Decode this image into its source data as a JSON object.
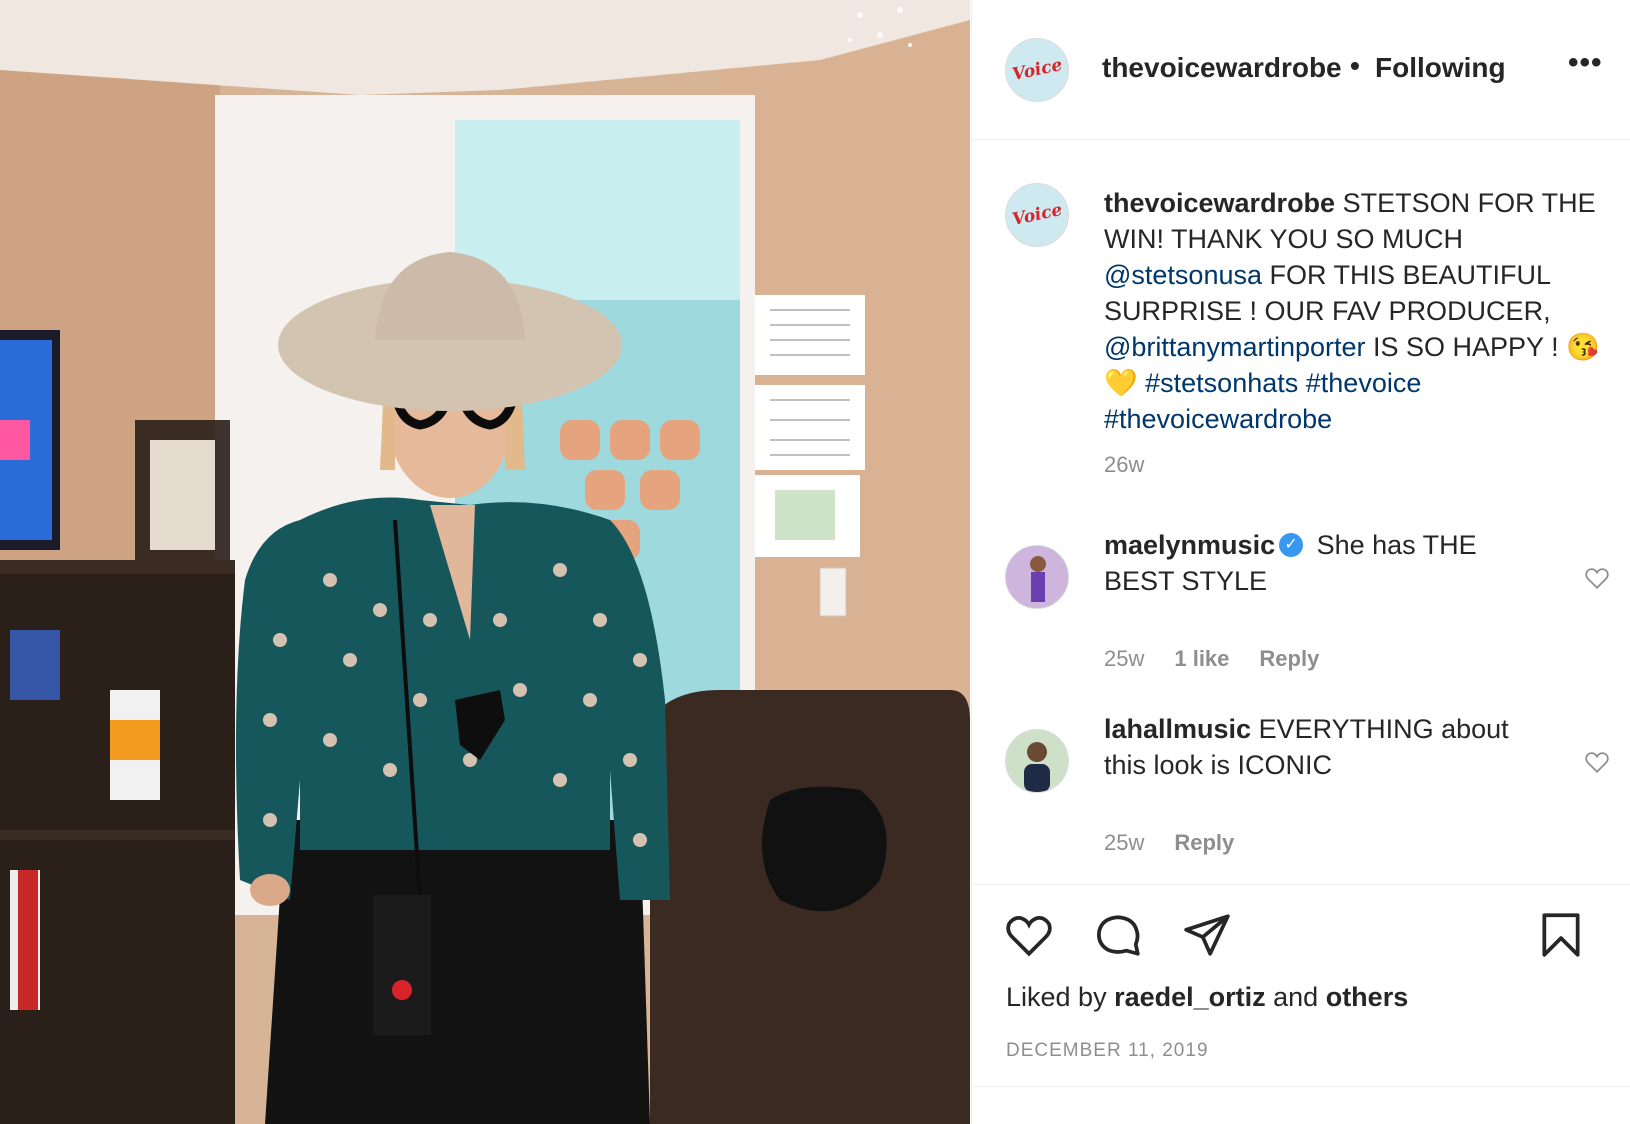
{
  "post": {
    "username": "thevoicewardrobe",
    "dot": "•",
    "following_label": "Following",
    "more_label": "•••",
    "avatar_logo_text": "Voice",
    "caption": {
      "username": "thevoicewardrobe",
      "part1": " STETSON FOR THE WIN! THANK YOU SO MUCH ",
      "mention1": "@stetsonusa",
      "part2": " FOR THIS BEAUTIFUL SURPRISE ! OUR FAV PRODUCER, ",
      "mention2": "@brittanymartinporter",
      "part3": " IS SO HAPPY ! ",
      "emojis": "😘💛",
      "tag1": "#stetsonhats",
      "tag2": "#thevoice",
      "tag3": "#thevoicewardrobe"
    },
    "caption_time": "26w"
  },
  "comments": [
    {
      "username": "maelynmusic",
      "verified": "✓",
      "text": " She has THE BEST STYLE",
      "time": "25w",
      "likes": "1 like",
      "reply": "Reply"
    },
    {
      "username": "lahallmusic",
      "text": " EVERYTHING about this look is ICONIC",
      "time": "25w",
      "reply": "Reply"
    }
  ],
  "footer": {
    "liked_by_prefix": "Liked by ",
    "liked_by_user": "raedel_ortiz",
    "liked_by_and": " and ",
    "liked_by_others": "others",
    "date": "DECEMBER 11, 2019"
  },
  "colors": {
    "link": "#00376b",
    "muted": "#8e8e8e",
    "verified": "#3897f0",
    "text": "#262626"
  },
  "icons": [
    "heart-icon",
    "comment-icon",
    "share-icon",
    "bookmark-icon",
    "more-options-icon",
    "verified-icon"
  ]
}
